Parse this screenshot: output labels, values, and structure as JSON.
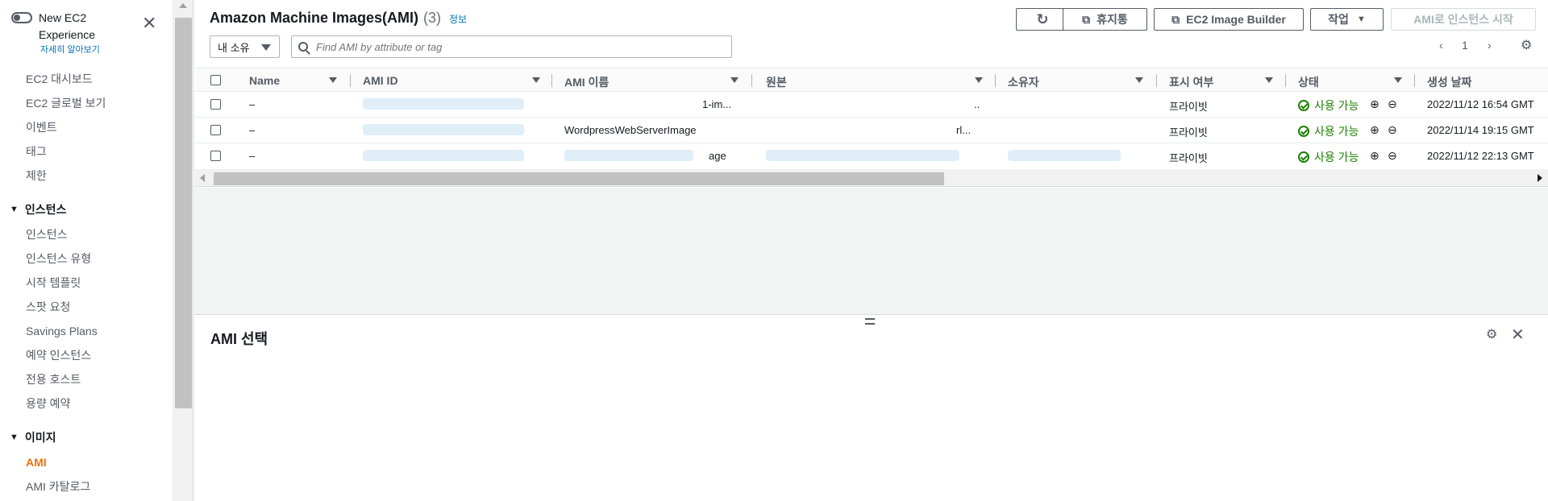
{
  "sidebar": {
    "toggle_label": "New EC2 Experience",
    "learn_more": "자세히 알아보기",
    "top_items": [
      {
        "label": "EC2 대시보드"
      },
      {
        "label": "EC2 글로벌 보기"
      },
      {
        "label": "이벤트"
      },
      {
        "label": "태그"
      },
      {
        "label": "제한"
      }
    ],
    "instances_section": "인스턴스",
    "instance_items": [
      {
        "label": "인스턴스"
      },
      {
        "label": "인스턴스 유형"
      },
      {
        "label": "시작 템플릿"
      },
      {
        "label": "스팟 요청"
      },
      {
        "label": "Savings Plans"
      },
      {
        "label": "예약 인스턴스"
      },
      {
        "label": "전용 호스트"
      },
      {
        "label": "용량 예약"
      }
    ],
    "images_section": "이미지",
    "image_items": [
      {
        "label": "AMI",
        "active": true
      },
      {
        "label": "AMI 카탈로그"
      }
    ]
  },
  "header": {
    "title": "Amazon Machine Images(AMI)",
    "count": "(3)",
    "info": "정보"
  },
  "toolbar": {
    "recycle_bin": "휴지통",
    "image_builder": "EC2 Image Builder",
    "actions": "작업",
    "launch": "AMI로 인스턴스 시작"
  },
  "filter": {
    "owner": "내 소유",
    "search_placeholder": "Find AMI by attribute or tag"
  },
  "pagination": {
    "current_page": "1"
  },
  "table": {
    "columns": [
      "Name",
      "AMI ID",
      "AMI 이름",
      "원본",
      "소유자",
      "표시 여부",
      "상태",
      "생성 날짜"
    ],
    "rows": [
      {
        "name": "–",
        "ami_id": "",
        "ami_name": "1-im...",
        "source": "..",
        "owner": "",
        "visibility": "프라이빗",
        "status": "사용 가능",
        "created": "2022/11/12 16:54 GMT"
      },
      {
        "name": "–",
        "ami_id": "",
        "ami_name": "WordpressWebServerImage",
        "source": "rl...",
        "owner": "",
        "visibility": "프라이빗",
        "status": "사용 가능",
        "created": "2022/11/14 19:15 GMT"
      },
      {
        "name": "–",
        "ami_id": "",
        "ami_name": "age",
        "source": "",
        "owner": "",
        "visibility": "프라이빗",
        "status": "사용 가능",
        "created": "2022/11/12 22:13 GMT"
      }
    ]
  },
  "detail": {
    "title": "AMI 선택"
  },
  "colors": {
    "accent": "#ec7211",
    "link": "#0073bb",
    "success": "#1d8102"
  }
}
